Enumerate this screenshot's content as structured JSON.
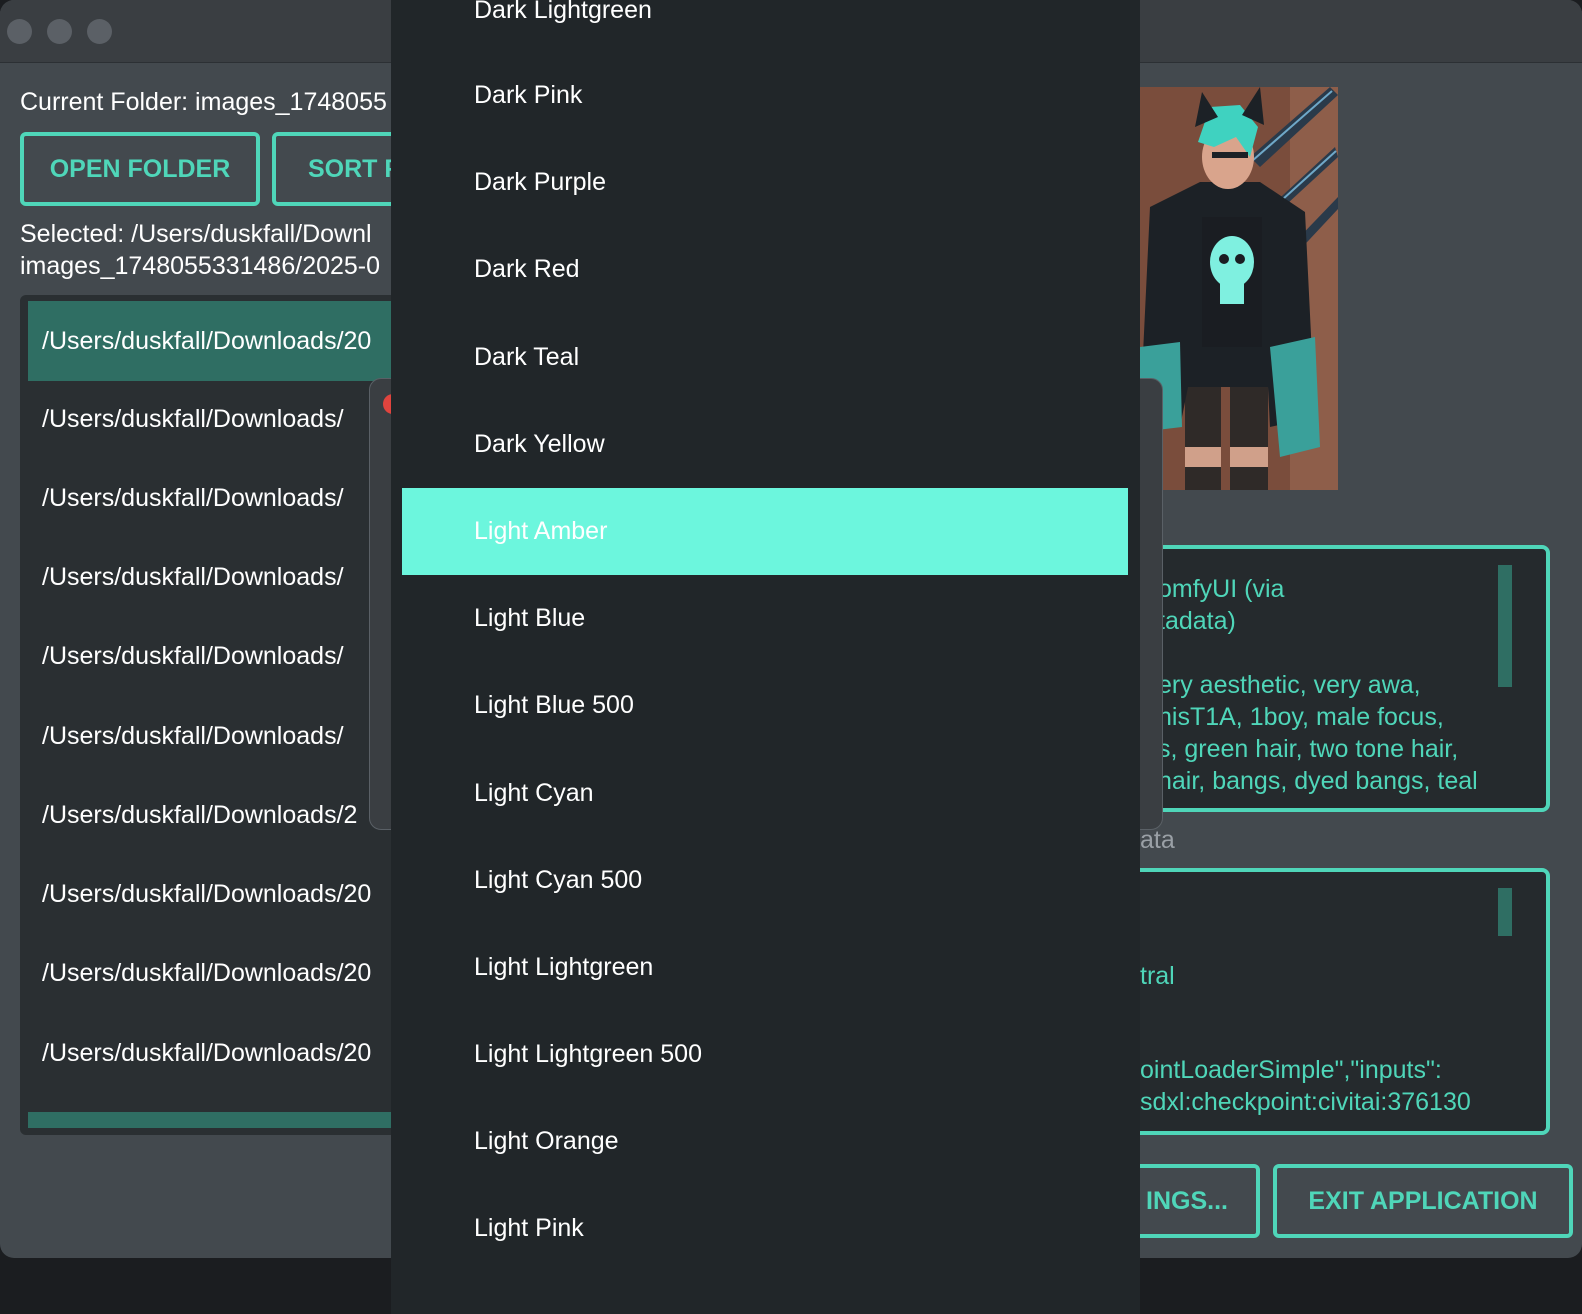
{
  "main": {
    "current_folder": "Current Folder: images_1748055",
    "open_folder_label": "OPEN FOLDER",
    "sort_label": "SORT F",
    "selected_line1": "Selected: /Users/duskfall/Downl",
    "selected_line2": "images_1748055331486/2025-0",
    "files": [
      "/Users/duskfall/Downloads/20",
      "/Users/duskfall/Downloads/",
      "/Users/duskfall/Downloads/",
      "/Users/duskfall/Downloads/",
      "/Users/duskfall/Downloads/",
      "/Users/duskfall/Downloads/",
      "/Users/duskfall/Downloads/2",
      "/Users/duskfall/Downloads/20",
      "/Users/duskfall/Downloads/20",
      "/Users/duskfall/Downloads/20"
    ]
  },
  "metadata": {
    "box1_lines": [
      "omfyUI (via",
      "tadata)",
      "ery aesthetic, very awa,",
      "hisT1A, 1boy, male focus,",
      "s, green hair, two tone hair,",
      "hair, bangs,  dyed bangs, teal"
    ],
    "label_partial": "ata",
    "box2_lines": [
      "tral",
      "ointLoaderSimple\",\"inputs\":",
      "sdxl:checkpoint:civitai:376130"
    ],
    "settings_label": "INGS...",
    "exit_label": "EXIT APPLICATION"
  },
  "dropdown": {
    "items": [
      "Dark Lightgreen",
      "Dark Pink",
      "Dark Purple",
      "Dark Red",
      "Dark Teal",
      "Dark Yellow",
      "Light Amber",
      "Light Blue",
      "Light Blue 500",
      "Light Cyan",
      "Light Cyan 500",
      "Light Lightgreen",
      "Light Lightgreen 500",
      "Light Orange",
      "Light Pink"
    ],
    "selected_index": 6
  },
  "colors": {
    "accent": "#4fd6b9",
    "selection_highlight": "#6cf6dd",
    "list_selected": "#2f6e63"
  }
}
